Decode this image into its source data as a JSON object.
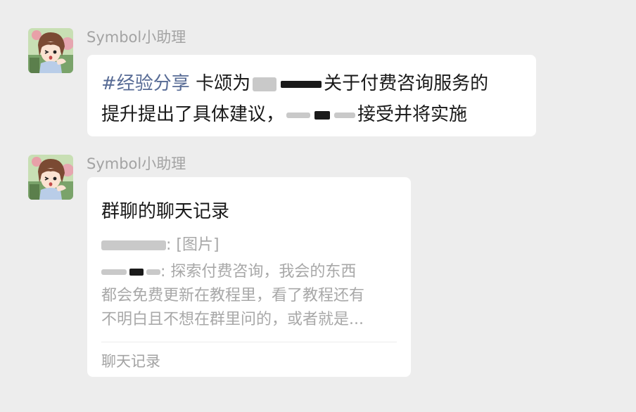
{
  "messages": [
    {
      "sender": "Symbol小助理",
      "hashtag": "#经验分享",
      "line1_prefix": "卡颂为",
      "line1_suffix": "关于付费咨询服务的",
      "line2_prefix": "提升提出了具体建议，",
      "line2_suffix": "接受并将实施"
    },
    {
      "sender": "Symbol小助理",
      "card": {
        "title": "群聊的聊天记录",
        "line1_suffix": ": [图片]",
        "line2_suffix": ": 探索付费咨询，我会的东西",
        "line3": "都会免费更新在教程里，看了教程还有",
        "line4": "不明白且不想在群里问的，或者就是...",
        "footer": "聊天记录"
      }
    }
  ]
}
